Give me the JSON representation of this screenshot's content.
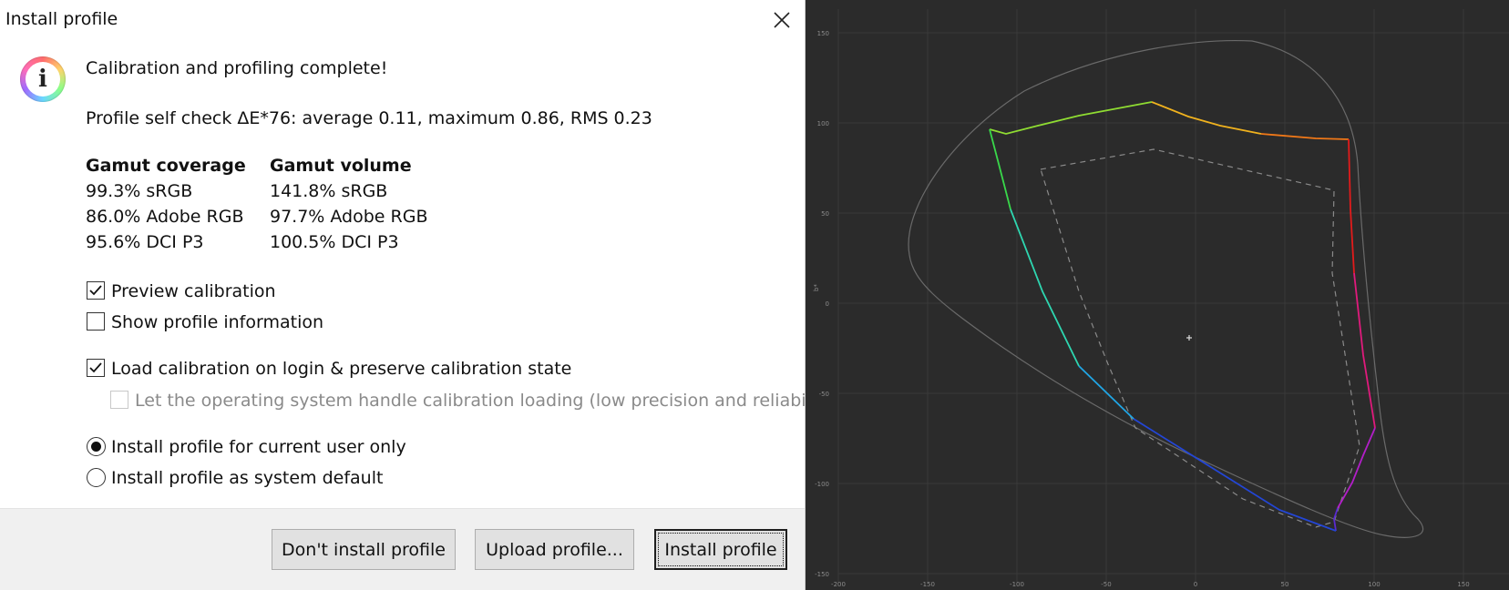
{
  "dialog": {
    "title": "Install profile",
    "headline": "Calibration and profiling complete!",
    "self_check": "Profile self check ΔE*76: average 0.11, maximum 0.86, RMS 0.23",
    "gamut": {
      "coverage_header": "Gamut coverage",
      "volume_header": "Gamut volume",
      "coverage": [
        "99.3% sRGB",
        "86.0% Adobe RGB",
        "95.6% DCI P3"
      ],
      "volume": [
        "141.8% sRGB",
        "97.7% Adobe RGB",
        "100.5% DCI P3"
      ]
    },
    "options": {
      "preview_calibration": {
        "label": "Preview calibration",
        "checked": true
      },
      "show_profile_info": {
        "label": "Show profile information",
        "checked": false
      },
      "load_calibration": {
        "label": "Load calibration on login & preserve calibration state",
        "checked": true
      },
      "os_handle": {
        "label": "Let the operating system handle calibration loading (low precision and reliability)",
        "checked": false,
        "disabled": true
      }
    },
    "install_scope": {
      "current_user": {
        "label": "Install profile for current user only",
        "selected": true
      },
      "system_default": {
        "label": "Install profile as system default",
        "selected": false
      }
    },
    "buttons": {
      "dont_install": "Don't install profile",
      "upload": "Upload profile...",
      "install": "Install profile"
    }
  },
  "plot": {
    "y_ticks": [
      "150",
      "100",
      "50",
      "0",
      "-50",
      "-100",
      "-150"
    ],
    "x_ticks": [
      "-200",
      "-150",
      "-100",
      "-50",
      "0",
      "50",
      "100",
      "150"
    ],
    "y_label": "b*",
    "colors": {
      "background": "#2b2b2b",
      "grid": "#3a3a3a",
      "outline": "#6a6a6a",
      "dashed": "#8a8a8a"
    }
  }
}
